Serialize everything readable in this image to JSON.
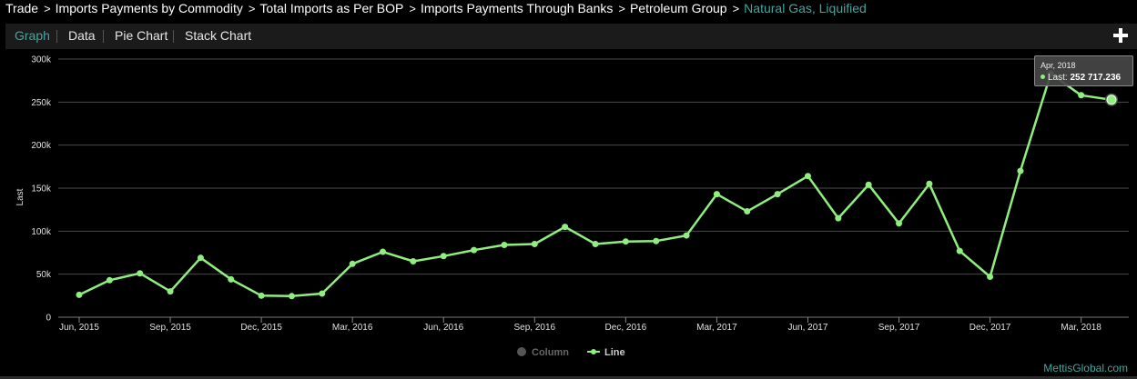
{
  "breadcrumb": {
    "items": [
      "Trade",
      "Imports Payments by Commodity",
      "Total Imports as Per BOP",
      "Imports Payments Through Banks",
      "Petroleum Group"
    ],
    "current": "Natural Gas, Liquified",
    "separator": ">"
  },
  "tabs": [
    "Graph",
    "Data",
    "Pie Chart",
    "Stack Chart"
  ],
  "active_tab": "Graph",
  "tooltip": {
    "date": "Apr, 2018",
    "series": "Last:",
    "value": "252 717.236"
  },
  "legend": {
    "column": "Column",
    "line": "Line"
  },
  "credits": "MettisGlobal.com",
  "colors": {
    "accent": "#3fa7a0",
    "line": "#90ee7e"
  },
  "chart_data": {
    "type": "line",
    "ylabel": "Last",
    "ylim": [
      0,
      300000
    ],
    "y_ticks": [
      0,
      50000,
      100000,
      150000,
      200000,
      250000,
      300000
    ],
    "y_tick_labels": [
      "0",
      "50k",
      "100k",
      "150k",
      "200k",
      "250k",
      "300k"
    ],
    "x_tick_labels": [
      "Jun, 2015",
      "Sep, 2015",
      "Dec, 2015",
      "Mar, 2016",
      "Jun, 2016",
      "Sep, 2016",
      "Dec, 2016",
      "Mar, 2017",
      "Jun, 2017",
      "Sep, 2017",
      "Dec, 2017",
      "Mar, 2018"
    ],
    "x": [
      "Jun, 2015",
      "Jul, 2015",
      "Aug, 2015",
      "Sep, 2015",
      "Oct, 2015",
      "Nov, 2015",
      "Dec, 2015",
      "Jan, 2016",
      "Feb, 2016",
      "Mar, 2016",
      "Apr, 2016",
      "May, 2016",
      "Jun, 2016",
      "Jul, 2016",
      "Aug, 2016",
      "Sep, 2016",
      "Oct, 2016",
      "Nov, 2016",
      "Dec, 2016",
      "Jan, 2017",
      "Feb, 2017",
      "Mar, 2017",
      "Apr, 2017",
      "May, 2017",
      "Jun, 2017",
      "Jul, 2017",
      "Aug, 2017",
      "Sep, 2017",
      "Oct, 2017",
      "Nov, 2017",
      "Dec, 2017",
      "Jan, 2018",
      "Feb, 2018",
      "Mar, 2018",
      "Apr, 2018"
    ],
    "series": [
      {
        "name": "Last",
        "values": [
          26000,
          43000,
          51000,
          30000,
          69000,
          44000,
          25000,
          24500,
          27500,
          62000,
          76000,
          65000,
          71000,
          78000,
          84000,
          85000,
          105000,
          85000,
          88000,
          88500,
          95000,
          143000,
          123000,
          143000,
          164000,
          115000,
          154000,
          109000,
          155000,
          77000,
          47000,
          170000,
          283000,
          258000,
          252717.236
        ]
      }
    ],
    "highlighted_index": 34,
    "grid": true
  }
}
